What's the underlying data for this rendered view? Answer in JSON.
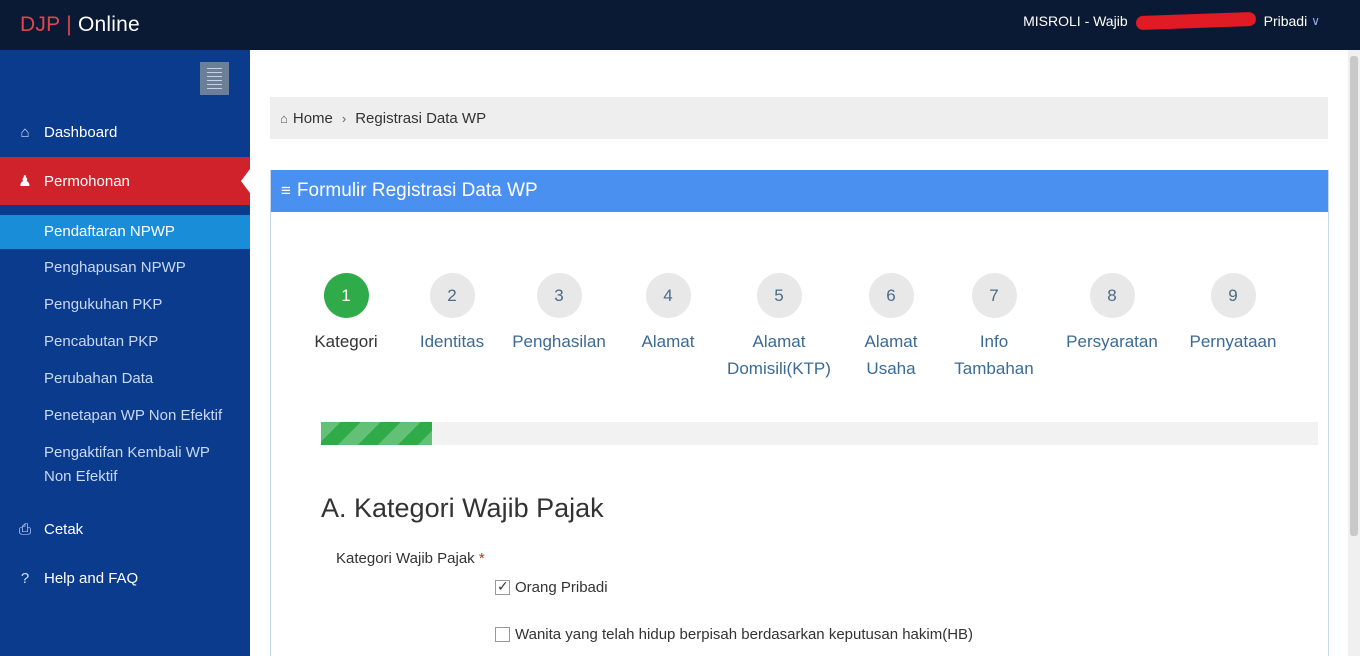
{
  "header": {
    "brand_prefix": "DJP",
    "brand_sep": "|",
    "brand_suffix": "Online",
    "user_visible": "MISROLI - Wajib",
    "user_tail": "Pribadi"
  },
  "sidebar": {
    "items": [
      {
        "label": "Dashboard",
        "icon": "home-icon"
      },
      {
        "label": "Permohonan",
        "icon": "user-icon"
      },
      {
        "label": "Cetak",
        "icon": "print-icon"
      },
      {
        "label": "Help and FAQ",
        "icon": "question-icon"
      }
    ],
    "submenu": [
      "Pendaftaran NPWP",
      "Penghapusan NPWP",
      "Pengukuhan PKP",
      "Pencabutan PKP",
      "Perubahan Data",
      "Penetapan WP Non Efektif",
      "Pengaktifan Kembali WP Non Efektif"
    ]
  },
  "breadcrumb": {
    "home": "Home",
    "current": "Registrasi Data WP"
  },
  "panel": {
    "title": "Formulir Registrasi Data WP"
  },
  "steps": [
    {
      "num": "1",
      "label": "Kategori"
    },
    {
      "num": "2",
      "label": "Identitas"
    },
    {
      "num": "3",
      "label": "Penghasilan"
    },
    {
      "num": "4",
      "label": "Alamat"
    },
    {
      "num": "5",
      "label": "Alamat Domisili(KTP)"
    },
    {
      "num": "6",
      "label": "Alamat Usaha"
    },
    {
      "num": "7",
      "label": "Info Tambahan"
    },
    {
      "num": "8",
      "label": "Persyaratan"
    },
    {
      "num": "9",
      "label": "Pernyataan"
    }
  ],
  "progress": {
    "current_step": 1,
    "total_steps": 9
  },
  "form": {
    "section_title": "A. Kategori Wajib Pajak",
    "field_label": "Kategori Wajib Pajak",
    "required_mark": "*",
    "options": [
      {
        "label": "Orang Pribadi",
        "checked": true
      },
      {
        "label": "Wanita yang telah hidup berpisah berdasarkan keputusan hakim(HB)",
        "checked": false
      }
    ]
  },
  "colors": {
    "topbar": "#0a1a35",
    "sidebar": "#0b3b8c",
    "active_nav": "#d0222a",
    "current_sub": "#1a8dd9",
    "panel_header": "#4a90f0",
    "step_done": "#2fab4a"
  }
}
